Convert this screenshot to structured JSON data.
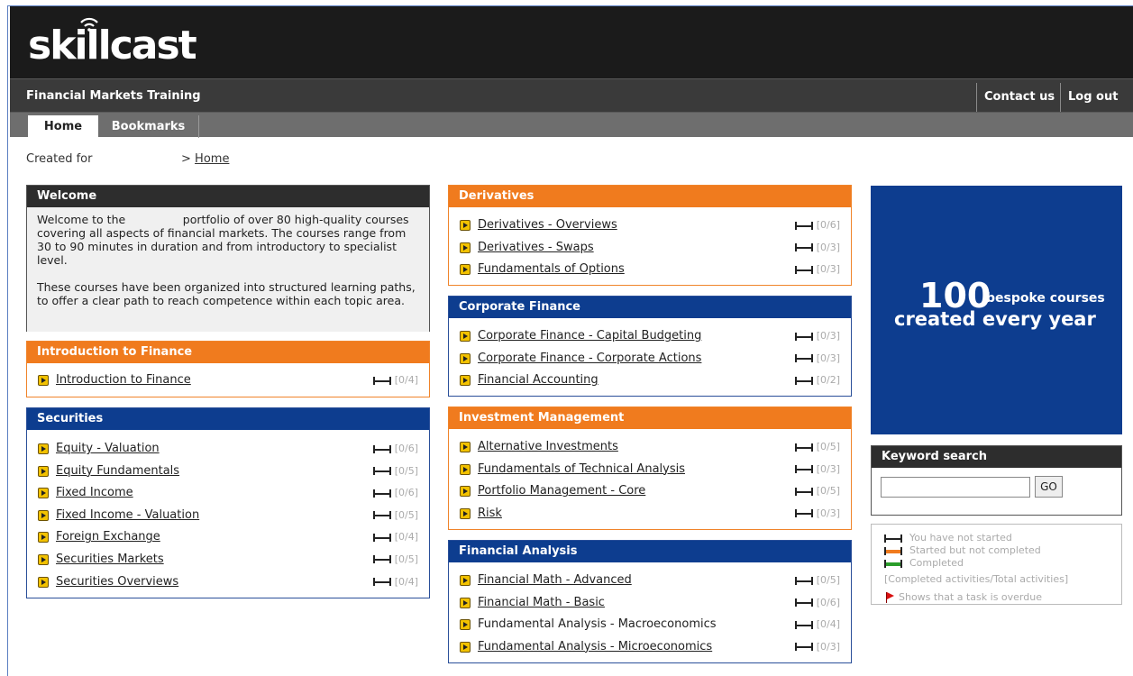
{
  "header": {
    "logo_text": "skillcast",
    "app_title": "Financial Markets Training",
    "contact_label": "Contact us",
    "logout_label": "Log out"
  },
  "tabs": {
    "home": "Home",
    "bookmarks": "Bookmarks"
  },
  "breadcrumb": {
    "created_for": "Created for",
    "separator": ">",
    "home_link": "Home"
  },
  "welcome": {
    "title": "Welcome",
    "para1": "Welcome to the                portfolio of over 80 high-quality courses covering all aspects of financial markets. The courses range from 30 to 90 minutes in duration and from introductory to specialist level.",
    "para2": "These courses have been organized into structured learning paths, to offer a clear path to reach competence within each topic area."
  },
  "sections": {
    "intro": {
      "title": "Introduction to Finance",
      "courses": [
        {
          "name": "Introduction to Finance",
          "progress": "[0/4]"
        }
      ]
    },
    "securities": {
      "title": "Securities",
      "courses": [
        {
          "name": "Equity - Valuation",
          "progress": "[0/6]"
        },
        {
          "name": "Equity Fundamentals",
          "progress": "[0/5]"
        },
        {
          "name": "Fixed Income",
          "progress": "[0/6]"
        },
        {
          "name": "Fixed Income - Valuation",
          "progress": "[0/5]"
        },
        {
          "name": "Foreign Exchange",
          "progress": "[0/4]"
        },
        {
          "name": "Securities Markets",
          "progress": "[0/5]"
        },
        {
          "name": "Securities Overviews",
          "progress": "[0/4]"
        }
      ]
    },
    "derivatives": {
      "title": "Derivatives",
      "courses": [
        {
          "name": "Derivatives - Overviews",
          "progress": "[0/6]"
        },
        {
          "name": "Derivatives - Swaps",
          "progress": "[0/3]"
        },
        {
          "name": "Fundamentals of Options",
          "progress": "[0/3]"
        }
      ]
    },
    "corporate": {
      "title": "Corporate Finance",
      "courses": [
        {
          "name": "Corporate Finance - Capital Budgeting",
          "progress": "[0/3]"
        },
        {
          "name": "Corporate Finance - Corporate Actions",
          "progress": "[0/3]"
        },
        {
          "name": "Financial Accounting",
          "progress": "[0/2]"
        }
      ]
    },
    "investment": {
      "title": "Investment Management",
      "courses": [
        {
          "name": "Alternative Investments",
          "progress": "[0/5]"
        },
        {
          "name": "Fundamentals of Technical Analysis",
          "progress": "[0/3]"
        },
        {
          "name": "Portfolio Management - Core",
          "progress": "[0/5]"
        },
        {
          "name": "Risk",
          "progress": "[0/3]"
        }
      ]
    },
    "analysis": {
      "title": "Financial Analysis",
      "courses": [
        {
          "name": "Financial Math - Advanced",
          "progress": "[0/5]"
        },
        {
          "name": "Financial Math - Basic",
          "progress": "[0/6]"
        },
        {
          "name": "Fundamental Analysis - Macroeconomics",
          "progress": "[0/4]"
        },
        {
          "name": "Fundamental Analysis - Microeconomics",
          "progress": "[0/3]"
        }
      ]
    }
  },
  "promo": {
    "number": "100",
    "small_text": "bespoke courses",
    "line2": "created every year"
  },
  "search": {
    "title": "Keyword search",
    "placeholder": "",
    "go_label": "GO"
  },
  "legend": {
    "not_started": "You have not started",
    "started": "Started but not completed",
    "completed": "Completed",
    "ratio": "[Completed activities/Total activities]",
    "overdue": "Shows that a task is overdue"
  },
  "colors": {
    "orange": "#f07b1e",
    "blue": "#0d3d8f",
    "dark": "#2d2d2d"
  }
}
